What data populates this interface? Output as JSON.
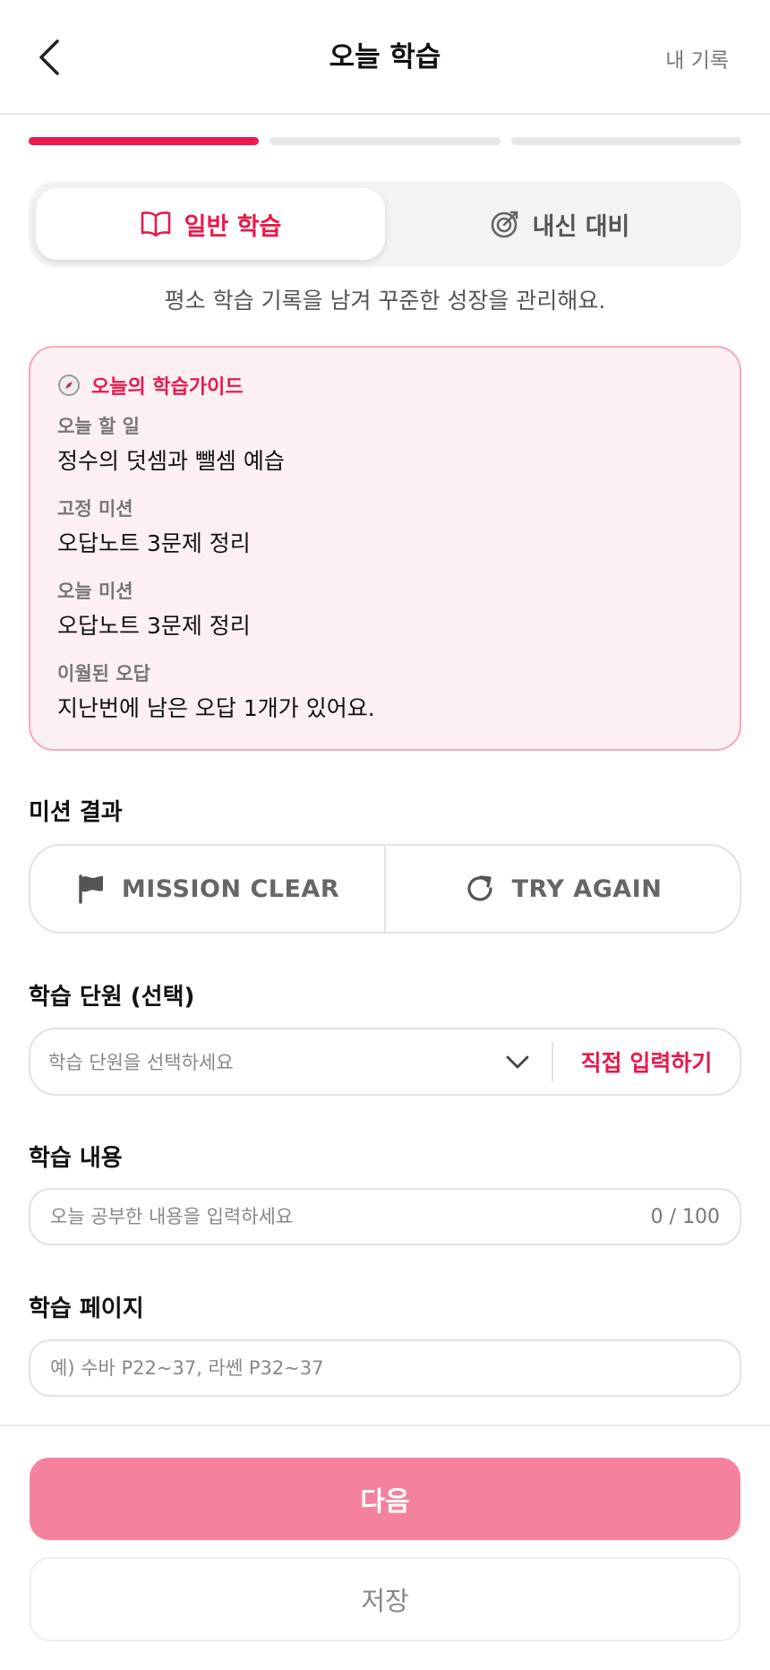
{
  "header": {
    "title": "오늘 학습",
    "right_link": "내 기록"
  },
  "progress": {
    "steps_total": 3,
    "current_step": 1,
    "accent": "#e8194b"
  },
  "mode_tabs": {
    "tabs": [
      {
        "label": "일반 학습",
        "icon": "book-open-icon",
        "selected": true
      },
      {
        "label": "내신 대비",
        "icon": "target-icon",
        "selected": false
      }
    ],
    "description": "평소 학습 기록을 남겨 꾸준한 성장을 관리해요."
  },
  "guide": {
    "title": "오늘의 학습가이드",
    "icon": "compass-icon",
    "items": [
      {
        "label": "오늘 할 일",
        "value": "정수의 덧셈과 뺄셈 예습"
      },
      {
        "label": "고정 미션",
        "value": "오답노트 3문제 정리"
      },
      {
        "label": "오늘 미션",
        "value": "오답노트 3문제 정리"
      },
      {
        "label": "이월된 오답",
        "value": "지난번에 남은 오답 1개가 있어요."
      }
    ]
  },
  "mission_result": {
    "title": "미션 결과",
    "clear_label": "MISSION CLEAR",
    "retry_label": "TRY AGAIN"
  },
  "unit": {
    "title": "학습 단원 (선택)",
    "placeholder": "학습 단원을 선택하세요",
    "direct_input": "직접 입력하기"
  },
  "content": {
    "title": "학습 내용",
    "placeholder": "오늘 공부한 내용을 입력하세요",
    "counter": "0 / 100"
  },
  "pages": {
    "title": "학습 페이지",
    "placeholder": "예) 수바 P22~37, 라쎈 P32~37"
  },
  "actions": {
    "next_label": "다음",
    "save_label": "저장"
  },
  "colors": {
    "accent": "#e8194b",
    "guide_bg": "#fdf0f3",
    "next_button": "#f4829d"
  }
}
